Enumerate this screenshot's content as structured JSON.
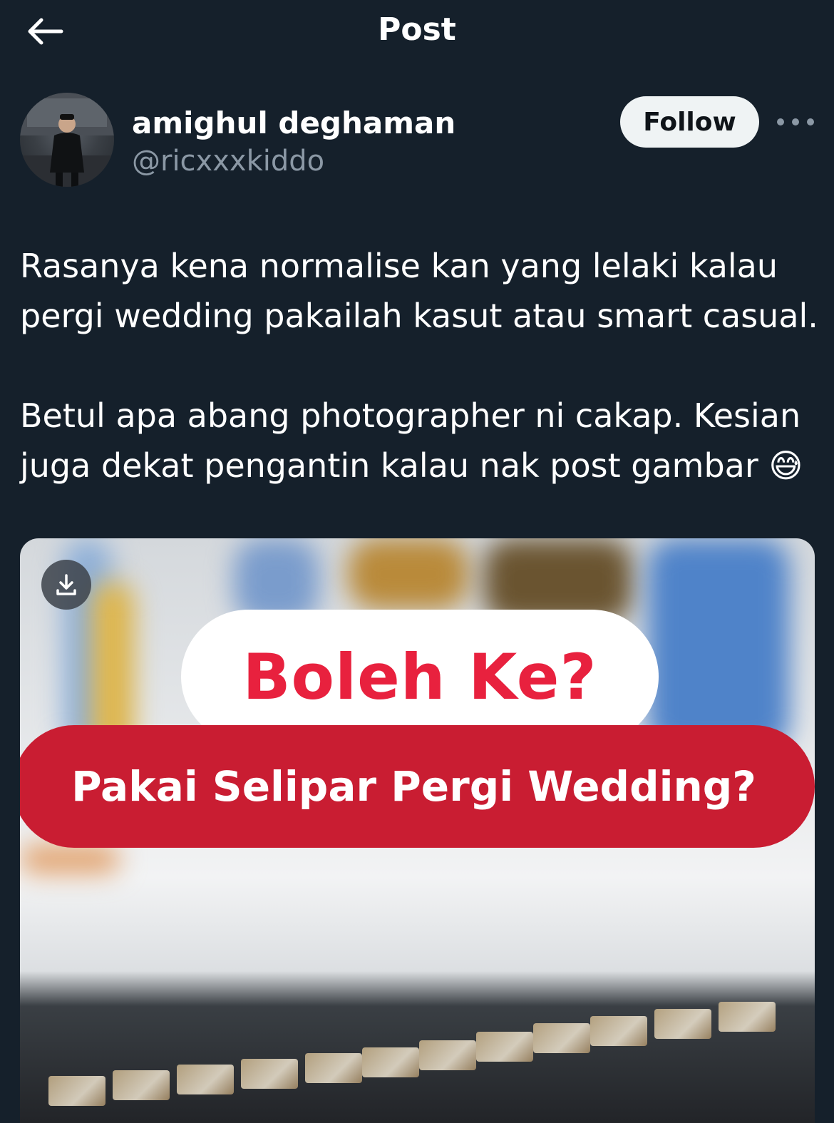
{
  "header": {
    "title": "Post",
    "back_icon": "arrow-left-icon"
  },
  "author": {
    "display_name": "amighul deghaman",
    "handle": "@ricxxxkiddo",
    "follow_label": "Follow",
    "more_icon": "more-horizontal-icon"
  },
  "post": {
    "paragraphs": [
      "Rasanya kena normalise kan yang lelaki kalau pergi wedding pakailah kasut atau smart casual.",
      "Betul apa abang photographer ni cakap. Kesian juga dekat pengantin kalau nak post gambar 😅"
    ]
  },
  "media": {
    "download_icon": "download-icon",
    "overlay_title": "Boleh Ke?",
    "overlay_subtitle": "Pakai Selipar Pergi Wedding?"
  },
  "colors": {
    "background": "#15202b",
    "text_secondary": "#8b98a5",
    "follow_bg": "#eff3f4",
    "accent_red": "#e8213e",
    "banner_red": "#c91d32"
  }
}
